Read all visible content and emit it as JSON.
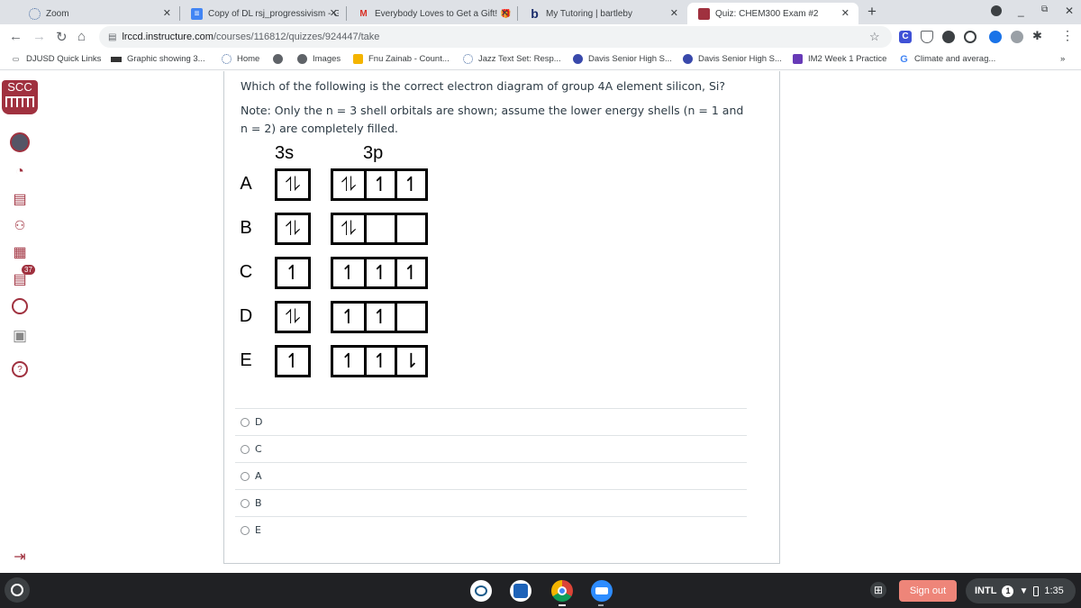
{
  "browser": {
    "tabs": [
      {
        "title": "Zoom",
        "icon": "zoom-favicon",
        "active": false
      },
      {
        "title": "Copy of DL rsj_progressivism - G",
        "icon": "google-docs-favicon",
        "active": false
      },
      {
        "title": "Everybody Loves to Get a Gift! 🎁",
        "icon": "gmail-favicon",
        "active": false
      },
      {
        "title": "My Tutoring | bartleby",
        "icon": "bartleby-favicon",
        "active": false
      },
      {
        "title": "Quiz: CHEM300 Exam #2",
        "icon": "scc-favicon",
        "active": true
      }
    ],
    "new_tab": "+",
    "url_host": "lrccd.instructure.com",
    "url_path": "/courses/116812/quizzes/924447/take",
    "bookmarks": [
      {
        "label": "DJUSD Quick Links",
        "icon": "folder-icon"
      },
      {
        "label": "Graphic showing 3...",
        "icon": "graphic-icon"
      },
      {
        "label": "Home",
        "icon": "zoom-favicon"
      },
      {
        "label": "",
        "icon": "globe-icon"
      },
      {
        "label": "Images",
        "icon": "globe-icon"
      },
      {
        "label": "Fnu Zainab - Count...",
        "icon": "slides-icon"
      },
      {
        "label": "Jazz Text Set: Resp...",
        "icon": "zoom-favicon"
      },
      {
        "label": "Davis Senior High S...",
        "icon": "dshs-icon"
      },
      {
        "label": "Davis Senior High S...",
        "icon": "dshs-icon"
      },
      {
        "label": "IM2 Week 1 Practice",
        "icon": "forms-icon"
      },
      {
        "label": "Climate and averag...",
        "icon": "google-icon"
      }
    ],
    "more_bookmarks": "»"
  },
  "sidebar": {
    "logo_text": "SCC",
    "inbox_badge": "37",
    "items": [
      "account",
      "dashboard",
      "courses",
      "groups",
      "calendar",
      "inbox",
      "history",
      "studio",
      "help"
    ],
    "collapse_icon": "collapse-arrow-icon"
  },
  "quiz": {
    "question": "Which of the following is the correct electron diagram of group 4A element silicon, Si?",
    "note": "Note: Only the n = 3 shell orbitals are shown; assume the lower energy shells  (n = 1 and n = 2) are completely filled.",
    "diagram": {
      "header_s": "3s",
      "header_p": "3p",
      "rows": [
        {
          "label": "A",
          "s": "⥮",
          "p": [
            "⥮",
            "↿",
            "↿"
          ]
        },
        {
          "label": "B",
          "s": "⥮",
          "p": [
            "⥮",
            "",
            ""
          ]
        },
        {
          "label": "C",
          "s": "↿",
          "p": [
            "↿",
            "↿",
            "↿"
          ]
        },
        {
          "label": "D",
          "s": "⥮",
          "p": [
            "↿",
            "↿",
            ""
          ]
        },
        {
          "label": "E",
          "s": "↿",
          "p": [
            "↿",
            "↿",
            "⇂"
          ]
        }
      ]
    },
    "answers": [
      "D",
      "C",
      "A",
      "B",
      "E"
    ]
  },
  "shelf": {
    "sign_out": "Sign out",
    "ime": "INTL",
    "notifications": "1",
    "time": "1:35"
  }
}
